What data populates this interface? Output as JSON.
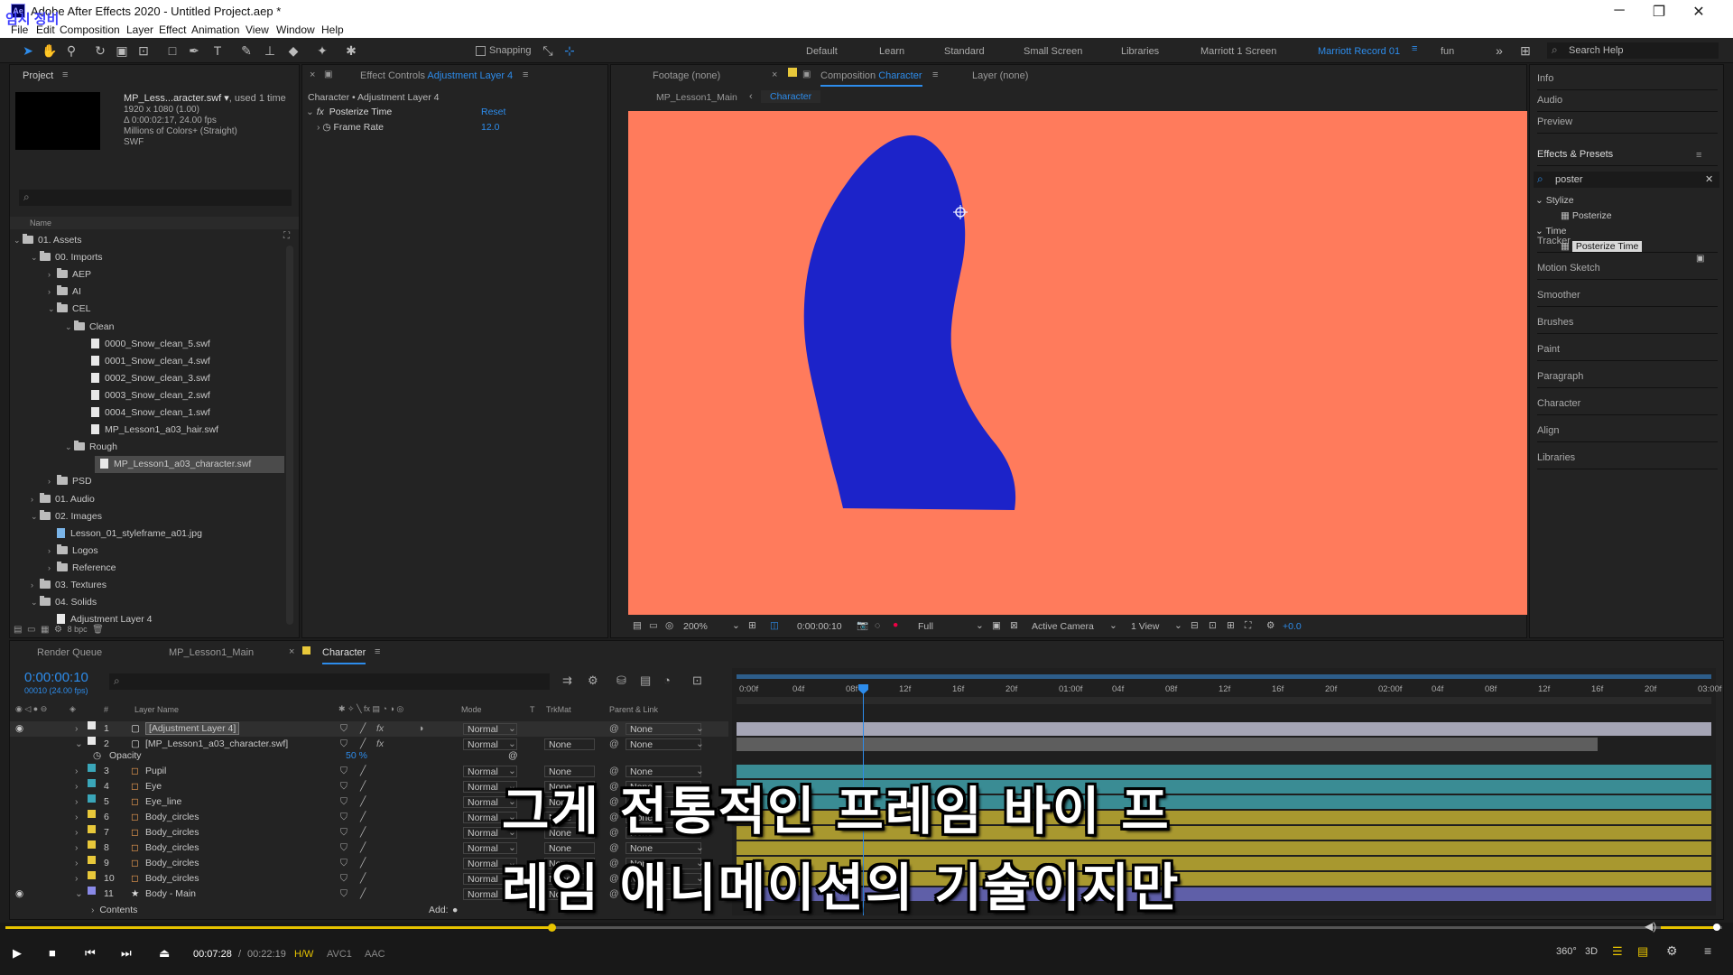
{
  "app": {
    "title": "Adobe After Effects 2020 - Untitled Project.aep *",
    "icon": "Ae",
    "watermark": "임시 정비"
  },
  "menu": [
    "File",
    "Edit",
    "Composition",
    "Layer",
    "Effect",
    "Animation",
    "View",
    "Window",
    "Help"
  ],
  "toolbar": {
    "snapping": "Snapping"
  },
  "workspaces": [
    "Default",
    "Learn",
    "Standard",
    "Small Screen",
    "Libraries",
    "Marriott 1 Screen",
    "Marriott Record 01",
    "fun"
  ],
  "search_help": "Search Help",
  "project": {
    "tab": "Project",
    "asset_name": "MP_Less...aracter.swf ▾",
    "asset_used": ", used 1 time",
    "asset_info": [
      "1920 x 1080 (1.00)",
      "Δ 0:00:02:17, 24.00 fps",
      "Millions of Colors+ (Straight)",
      "SWF"
    ],
    "col_name": "Name",
    "bpc": "8 bpc",
    "tree": [
      {
        "label": "01. Assets",
        "level": 0,
        "type": "folder",
        "open": true
      },
      {
        "label": "00. Imports",
        "level": 1,
        "type": "folder",
        "open": true
      },
      {
        "label": "AEP",
        "level": 2,
        "type": "folder",
        "open": false
      },
      {
        "label": "AI",
        "level": 2,
        "type": "folder",
        "open": false
      },
      {
        "label": "CEL",
        "level": 2,
        "type": "folder",
        "open": true
      },
      {
        "label": "Clean",
        "level": 3,
        "type": "folder",
        "open": true
      },
      {
        "label": "0000_Snow_clean_5.swf",
        "level": 4,
        "type": "file"
      },
      {
        "label": "0001_Snow_clean_4.swf",
        "level": 4,
        "type": "file"
      },
      {
        "label": "0002_Snow_clean_3.swf",
        "level": 4,
        "type": "file"
      },
      {
        "label": "0003_Snow_clean_2.swf",
        "level": 4,
        "type": "file"
      },
      {
        "label": "0004_Snow_clean_1.swf",
        "level": 4,
        "type": "file"
      },
      {
        "label": "MP_Lesson1_a03_hair.swf",
        "level": 4,
        "type": "file"
      },
      {
        "label": "Rough",
        "level": 3,
        "type": "folder",
        "open": true
      },
      {
        "label": "MP_Lesson1_a03_character.swf",
        "level": 4,
        "type": "file",
        "selected": true
      },
      {
        "label": "PSD",
        "level": 2,
        "type": "folder",
        "open": false
      },
      {
        "label": "01. Audio",
        "level": 1,
        "type": "folder",
        "open": false
      },
      {
        "label": "02. Images",
        "level": 1,
        "type": "folder",
        "open": true
      },
      {
        "label": "Lesson_01_styleframe_a01.jpg",
        "level": 2,
        "type": "image"
      },
      {
        "label": "Logos",
        "level": 2,
        "type": "folder",
        "open": false
      },
      {
        "label": "Reference",
        "level": 2,
        "type": "folder",
        "open": false
      },
      {
        "label": "03. Textures",
        "level": 1,
        "type": "folder",
        "open": false
      },
      {
        "label": "04. Solids",
        "level": 1,
        "type": "folder",
        "open": true
      },
      {
        "label": "Adjustment Layer 4",
        "level": 2,
        "type": "solid"
      }
    ]
  },
  "effect_controls": {
    "tab_prefix": "Effect Controls",
    "tab_layer": "Adjustment Layer 4",
    "breadcrumb": "Character • Adjustment Layer 4",
    "effect_name": "Posterize Time",
    "reset": "Reset",
    "param": "Frame Rate",
    "param_value": "12.0"
  },
  "viewer": {
    "footage_tab": "Footage  (none)",
    "comp_tab_prefix": "Composition",
    "comp_tab_name": "Character",
    "layer_tab": "Layer  (none)",
    "crumbs": [
      "MP_Lesson1_Main",
      "Character"
    ],
    "bg_color": "#ff7b5c",
    "shape_color": "#1c23c9",
    "zoom": "200%",
    "timecode": "0:00:00:10",
    "resolution": "Full",
    "camera": "Active Camera",
    "views": "1 View",
    "exposure": "+0.0"
  },
  "right_panels": [
    "Info",
    "Audio",
    "Preview",
    "Effects & Presets",
    "Tracker",
    "Motion Sketch",
    "Smoother",
    "Brushes",
    "Paint",
    "Paragraph",
    "Character",
    "Align",
    "Libraries"
  ],
  "effects_search": "poster",
  "effects_tree": [
    {
      "label": "Stylize",
      "kind": "group"
    },
    {
      "label": "Posterize",
      "kind": "fx"
    },
    {
      "label": "Time",
      "kind": "group"
    },
    {
      "label": "Posterize Time",
      "kind": "fx",
      "selected": true
    }
  ],
  "timeline": {
    "tabs": [
      "Render Queue",
      "MP_Lesson1_Main",
      "Character"
    ],
    "timecode": "0:00:00:10",
    "fps": "00010 (24.00 fps)",
    "headers": {
      "name": "Layer Name",
      "mode": "Mode",
      "t": "T",
      "trkmat": "TrkMat",
      "parent": "Parent & Link",
      "num": "#"
    },
    "ruler": [
      "0:00f",
      "04f",
      "08f",
      "12f",
      "16f",
      "20f",
      "01:00f",
      "04f",
      "08f",
      "12f",
      "16f",
      "20f",
      "02:00f",
      "04f",
      "08f",
      "12f",
      "16f",
      "20f",
      "03:00f"
    ],
    "opacity_label": "Opacity",
    "opacity_value": "50 %",
    "contents_label": "Contents",
    "add_label": "Add:",
    "layers": [
      {
        "num": "1",
        "name": "[Adjustment Layer 4]",
        "color": "#e8e8e8",
        "mode": "Normal",
        "trk": "",
        "parent": "None",
        "bar": "#a5a5b5",
        "kind": "adj"
      },
      {
        "num": "2",
        "name": "[MP_Lesson1_a03_character.swf]",
        "color": "#e8e8e8",
        "mode": "Normal",
        "trk": "None",
        "parent": "None",
        "bar": "#5e5e5e",
        "kind": "swf"
      },
      {
        "num": "3",
        "name": "Pupil",
        "color": "#3aa6b9",
        "mode": "Normal",
        "trk": "None",
        "parent": "None",
        "bar": "#3a8c94",
        "kind": "shape"
      },
      {
        "num": "4",
        "name": "Eye",
        "color": "#3aa6b9",
        "mode": "Normal",
        "trk": "None",
        "parent": "None",
        "bar": "#3a8c94",
        "kind": "shape"
      },
      {
        "num": "5",
        "name": "Eye_line",
        "color": "#3aa6b9",
        "mode": "Normal",
        "trk": "None",
        "parent": "None",
        "bar": "#3a8c94",
        "kind": "shape"
      },
      {
        "num": "6",
        "name": "Body_circles",
        "color": "#e8c83a",
        "mode": "Normal",
        "trk": "None",
        "parent": "None",
        "bar": "#a8982f",
        "kind": "shape"
      },
      {
        "num": "7",
        "name": "Body_circles",
        "color": "#e8c83a",
        "mode": "Normal",
        "trk": "None",
        "parent": "None",
        "bar": "#a8982f",
        "kind": "shape"
      },
      {
        "num": "8",
        "name": "Body_circles",
        "color": "#e8c83a",
        "mode": "Normal",
        "trk": "None",
        "parent": "None",
        "bar": "#a8982f",
        "kind": "shape"
      },
      {
        "num": "9",
        "name": "Body_circles",
        "color": "#e8c83a",
        "mode": "Normal",
        "trk": "None",
        "parent": "None",
        "bar": "#a8982f",
        "kind": "shape"
      },
      {
        "num": "10",
        "name": "Body_circles",
        "color": "#e8c83a",
        "mode": "Normal",
        "trk": "None",
        "parent": "None",
        "bar": "#a8982f",
        "kind": "shape"
      },
      {
        "num": "11",
        "name": "Body - Main",
        "color": "#8a8ae8",
        "mode": "Normal",
        "trk": "None",
        "parent": "None",
        "bar": "#5f5fa8",
        "kind": "star"
      }
    ]
  },
  "subtitles": [
    "그게 전통적인 프레임 바이 프",
    "레임 애니메이션의 기술이지만"
  ],
  "player": {
    "current": "00:07:28",
    "separator": "/",
    "total": "00:22:19",
    "hw": "H/W",
    "codec": "AVC1",
    "audio": "AAC",
    "progress": 0.318
  }
}
